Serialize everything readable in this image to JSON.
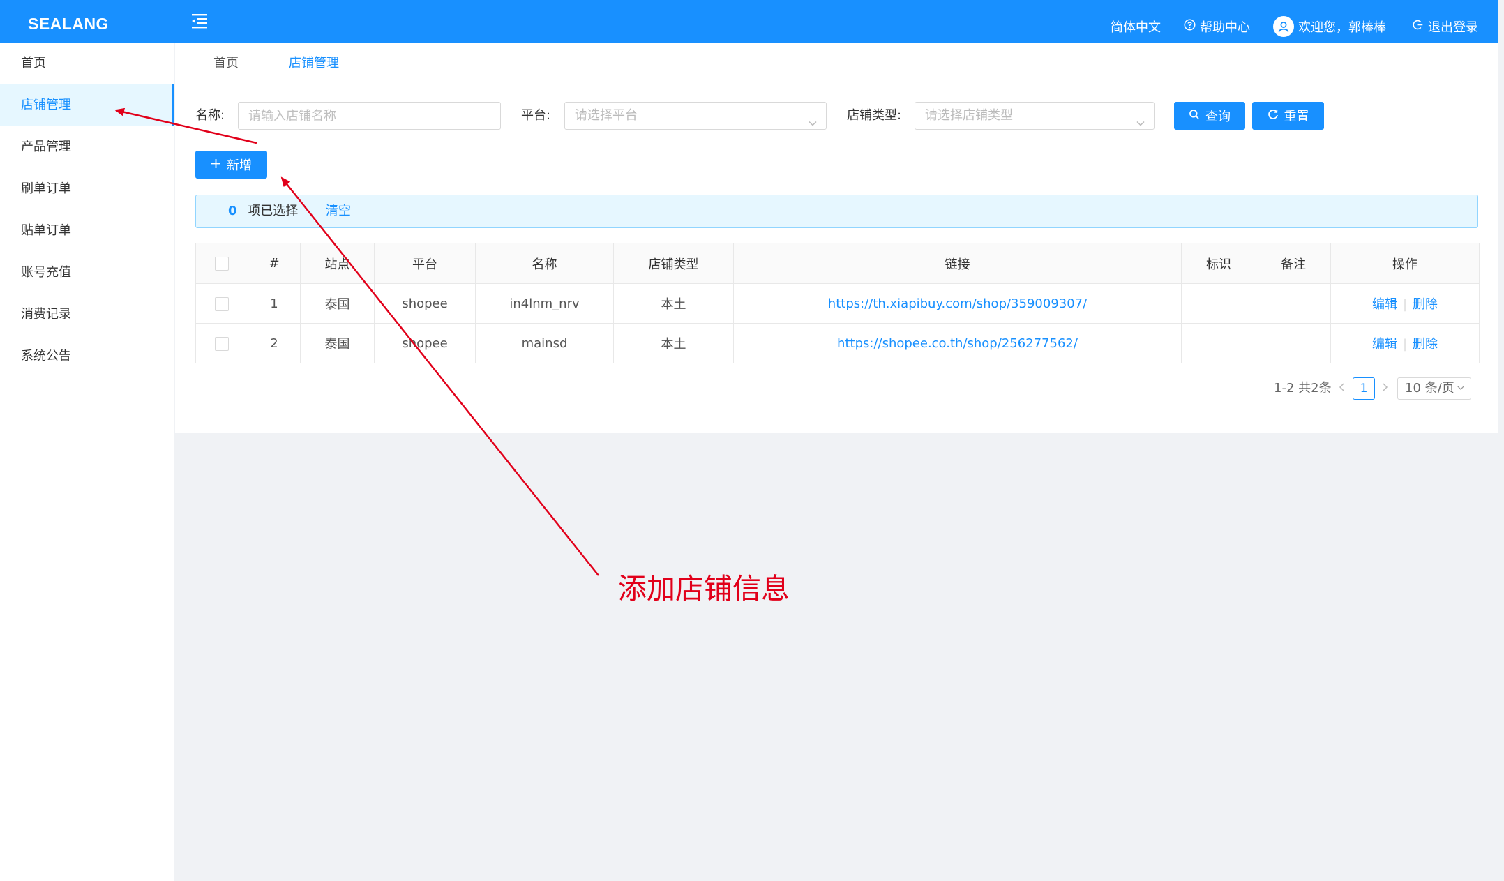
{
  "header": {
    "logo": "SEALANG",
    "language": "简体中文",
    "help": "帮助中心",
    "welcome": "欢迎您，郭棒棒",
    "logout": "退出登录",
    "color": "#1890ff"
  },
  "sidebar": {
    "items": [
      {
        "label": "首页"
      },
      {
        "label": "店铺管理"
      },
      {
        "label": "产品管理"
      },
      {
        "label": "刷单订单"
      },
      {
        "label": "贴单订单"
      },
      {
        "label": "账号充值"
      },
      {
        "label": "消费记录"
      },
      {
        "label": "系统公告"
      }
    ],
    "active_index": 1
  },
  "tabs": [
    {
      "label": "首页"
    },
    {
      "label": "店铺管理"
    }
  ],
  "filters": {
    "name_label": "名称:",
    "name_placeholder": "请输入店铺名称",
    "platform_label": "平台:",
    "platform_placeholder": "请选择平台",
    "type_label": "店铺类型:",
    "type_placeholder": "请选择店铺类型",
    "query_button": "查询",
    "reset_button": "重置"
  },
  "add_button": "新增",
  "selection": {
    "count": "0",
    "text": "项已选择",
    "clear": "清空"
  },
  "table": {
    "headers": [
      "#",
      "站点",
      "平台",
      "名称",
      "店铺类型",
      "链接",
      "标识",
      "备注",
      "操作"
    ],
    "rows": [
      {
        "index": "1",
        "site": "泰国",
        "platform": "shopee",
        "name": "in4lnm_nrv",
        "type": "本土",
        "link": "https://th.xiapibuy.com/shop/359009307/",
        "mark": "",
        "note": "",
        "edit": "编辑",
        "delete": "删除"
      },
      {
        "index": "2",
        "site": "泰国",
        "platform": "shopee",
        "name": "mainsd",
        "type": "本土",
        "link": "https://shopee.co.th/shop/256277562/",
        "mark": "",
        "note": "",
        "edit": "编辑",
        "delete": "删除"
      }
    ]
  },
  "pagination": {
    "summary": "1-2 共2条",
    "current_page": "1",
    "page_size": "10 条/页"
  },
  "annotation": {
    "text": "添加店铺信息",
    "color": "#e1001a"
  }
}
